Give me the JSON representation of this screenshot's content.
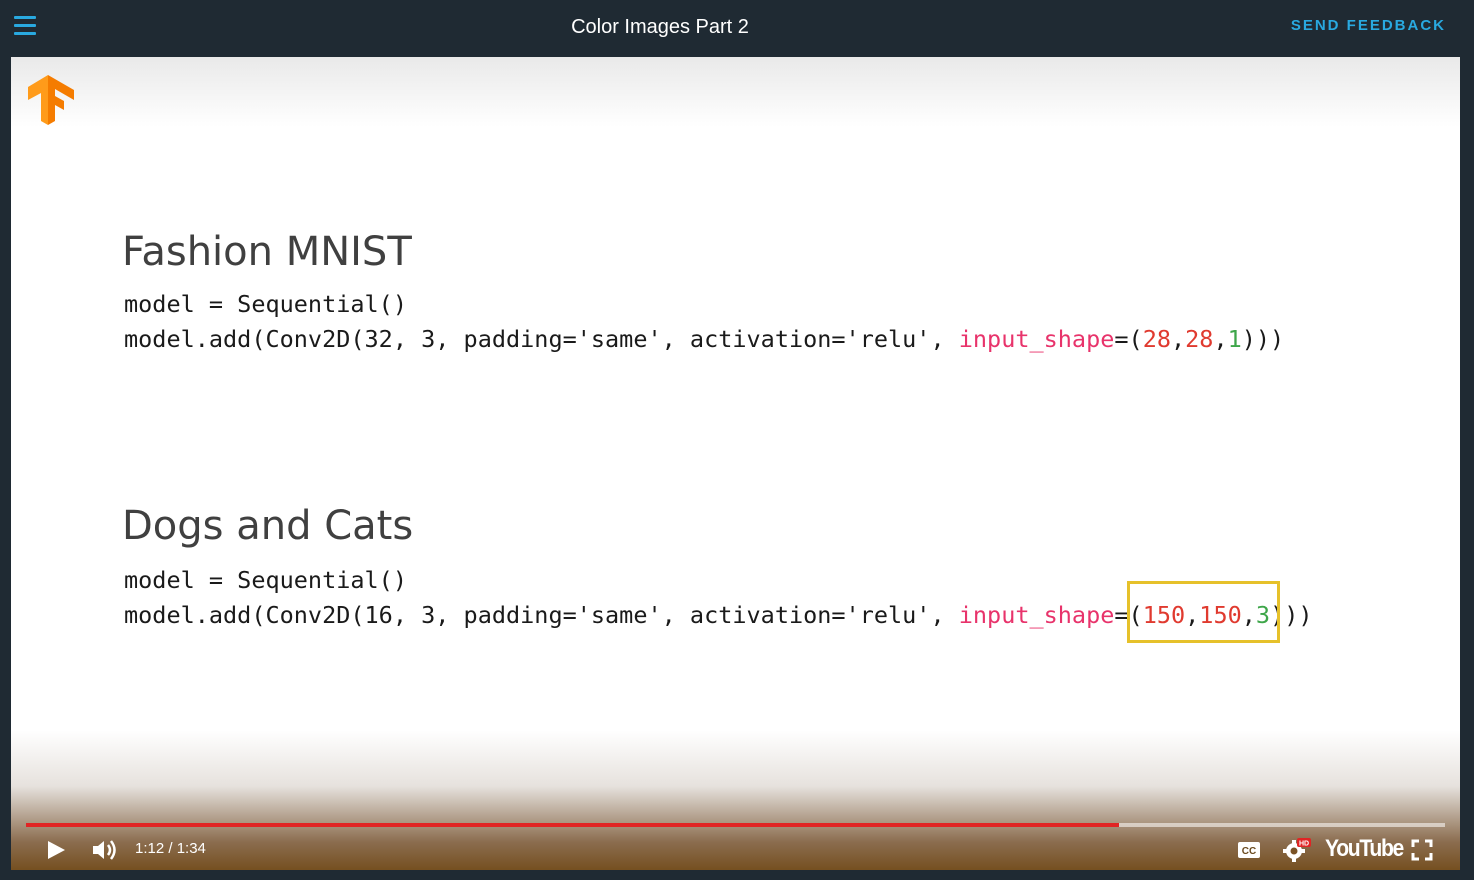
{
  "header": {
    "title": "Color Images Part 2",
    "feedback_label": "SEND FEEDBACK"
  },
  "slide": {
    "section1": {
      "heading": "Fashion MNIST",
      "line1": "model = Sequential()",
      "line2_prefix": "model.add(Conv2D(32, 3, padding='same', activation='relu', ",
      "kw": "input_shape",
      "eq_paren": "=(",
      "n1": "28",
      "n2": "28",
      "n3": "1",
      "comma": ",",
      "close": ")))"
    },
    "section2": {
      "heading": "Dogs and Cats",
      "line1": "model = Sequential()",
      "line2_prefix": "model.add(Conv2D(16, 3, padding='same', activation='relu', ",
      "kw": "input_shape",
      "eq_paren": "=(",
      "n1": "150",
      "n2": "150",
      "n3": "3",
      "comma": ",",
      "close": ")))"
    }
  },
  "player": {
    "time": "1:12 / 1:34",
    "progress_fraction": 0.77,
    "brand": "YouTube",
    "hd_badge": "HD",
    "cc_label": "CC",
    "accent_color": "#e02424"
  },
  "icons": [
    "menu-icon",
    "tensorflow-logo",
    "play-icon",
    "volume-icon",
    "captions-icon",
    "settings-icon",
    "fullscreen-icon"
  ]
}
